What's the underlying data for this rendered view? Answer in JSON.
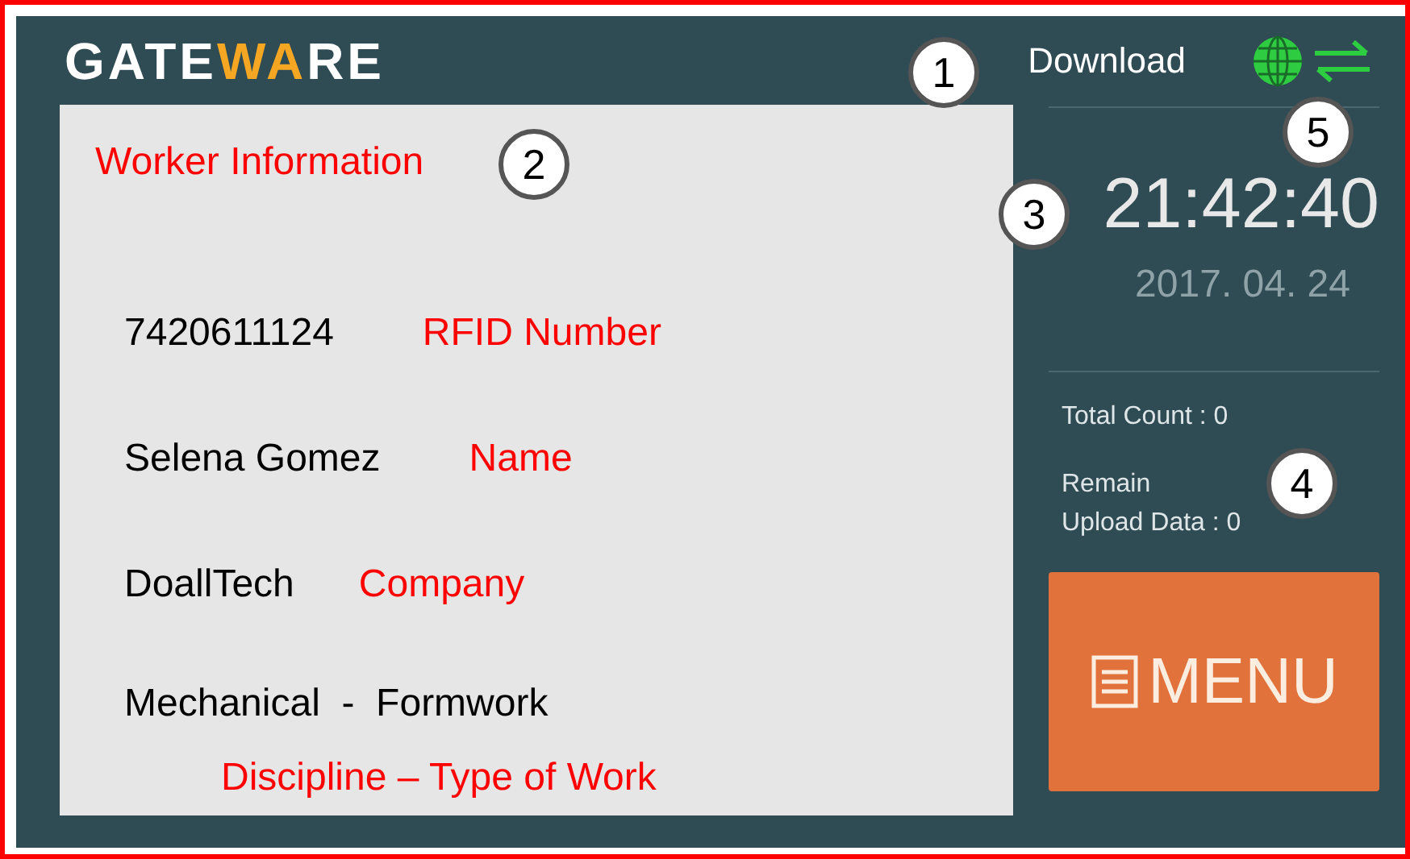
{
  "logo": [
    {
      "text": "GATE",
      "accent": false
    },
    {
      "text": "WA",
      "accent": true
    },
    {
      "text": "RE",
      "accent": false
    }
  ],
  "download": "Download",
  "worker_panel": {
    "title": "Worker Information",
    "fields": [
      {
        "value": "7420611124",
        "label": "RFID Number"
      },
      {
        "value": "Selena Gomez",
        "label": "Name"
      },
      {
        "value": "DoallTech",
        "label": "Company"
      },
      {
        "value": "Mechanical  -  Formwork",
        "label": "Discipline – Type of Work"
      }
    ]
  },
  "clock": {
    "time": "21:42:40",
    "date": "2017. 04. 24"
  },
  "counts": {
    "total": "Total Count : 0",
    "remain_line1": "Remain",
    "remain_line2": "Upload Data : 0"
  },
  "menu_button": "MENU",
  "callouts": [
    "1",
    "2",
    "3",
    "4",
    "5"
  ]
}
